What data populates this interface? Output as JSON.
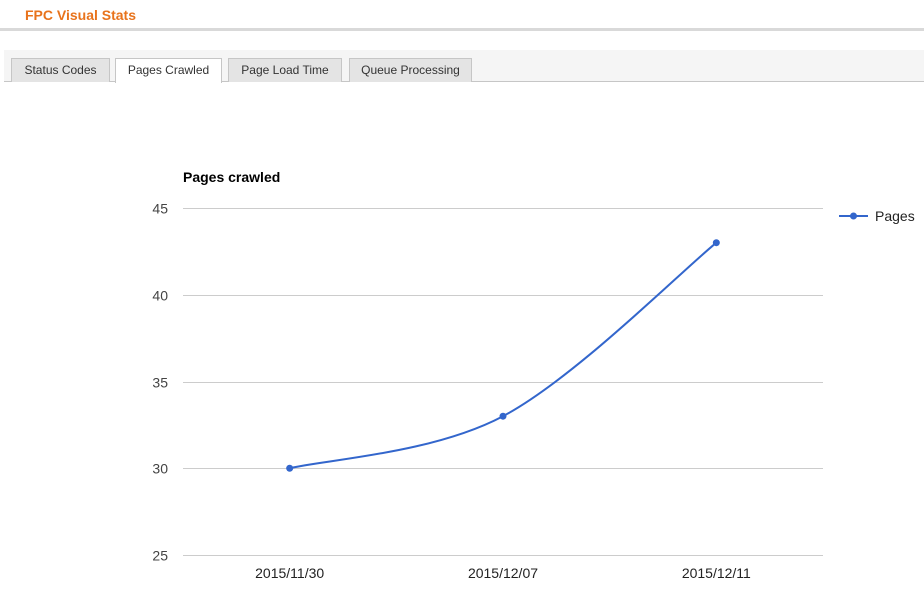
{
  "app": {
    "title": "FPC Visual Stats"
  },
  "tabs": [
    {
      "label": "Status Codes",
      "active": false
    },
    {
      "label": "Pages Crawled",
      "active": true
    },
    {
      "label": "Page Load Time",
      "active": false
    },
    {
      "label": "Queue Processing",
      "active": false
    }
  ],
  "colors": {
    "brand": "#e8731c",
    "series": "#3366cc",
    "gridline": "#cccccc"
  },
  "chart_data": {
    "type": "line",
    "title": "Pages crawled",
    "categories": [
      "2015/11/30",
      "2015/12/07",
      "2015/12/11"
    ],
    "series": [
      {
        "name": "Pages",
        "values": [
          30,
          33,
          43
        ]
      }
    ],
    "ylim": [
      25,
      45
    ],
    "yticks": [
      25,
      30,
      35,
      40,
      45
    ],
    "grid": true,
    "legend_position": "right",
    "curve": "smooth"
  }
}
